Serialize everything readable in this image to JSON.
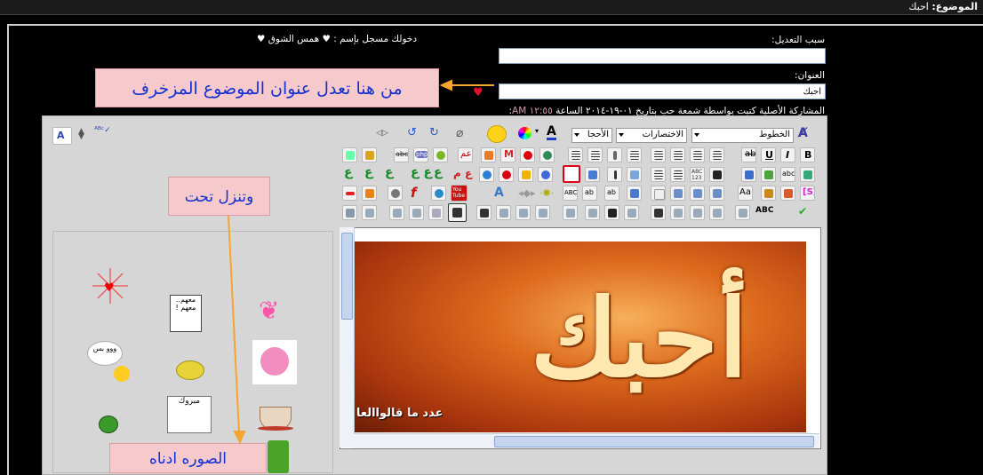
{
  "topbar": {
    "label": "الموضوع:",
    "value": "احبك"
  },
  "logged_in": "دخولك مسجل بإسم : ♥ همس الشوق ♥",
  "edit_reason": {
    "label": "سبب التعديل:",
    "value": ""
  },
  "title_field": {
    "label": "العنوان:",
    "value": "احبك"
  },
  "original_post": {
    "text": "المشاركة الأصلية كتبت بواسطة شمعة حب بتاريخ ٠١-١٩-٢٠١٤ الساعة",
    "time": "١٢:٥٥ AM",
    "suffix": ":"
  },
  "callouts": {
    "title_hint": "من هنا تعدل عنوان الموضوع المزخرف",
    "scroll_hint": "وتنزل تحت",
    "image_hint": "الصوره ادناه"
  },
  "toolbar": {
    "font_select": "الخطوط",
    "shortcuts_select": "الاختصارات",
    "size_select": "الأحجا",
    "font_color_letter": "A"
  },
  "preview": {
    "image_caption": "عدد ما قالواالعا",
    "image_title_glyphs": "أحبك"
  },
  "colors": {
    "accent_arrow": "#f3a530",
    "callout_bg": "#f6c9cd",
    "callout_text": "#1330d0",
    "editor_bg": "#d6d6d6"
  },
  "smilies": [
    {
      "name": "heart-sparkle-smilie"
    },
    {
      "name": "sign-smilie",
      "text": "معهم.. معهم !"
    },
    {
      "name": "butterfly-smilie"
    },
    {
      "name": "gossip-smilie",
      "text": "ووو بس"
    },
    {
      "name": "lemon-smilie"
    },
    {
      "name": "pink-bunny-smilie"
    },
    {
      "name": "mabrook-smilie",
      "text": "مبروك"
    },
    {
      "name": "coffee-cup-smilie"
    },
    {
      "name": "melon-smilie"
    }
  ]
}
